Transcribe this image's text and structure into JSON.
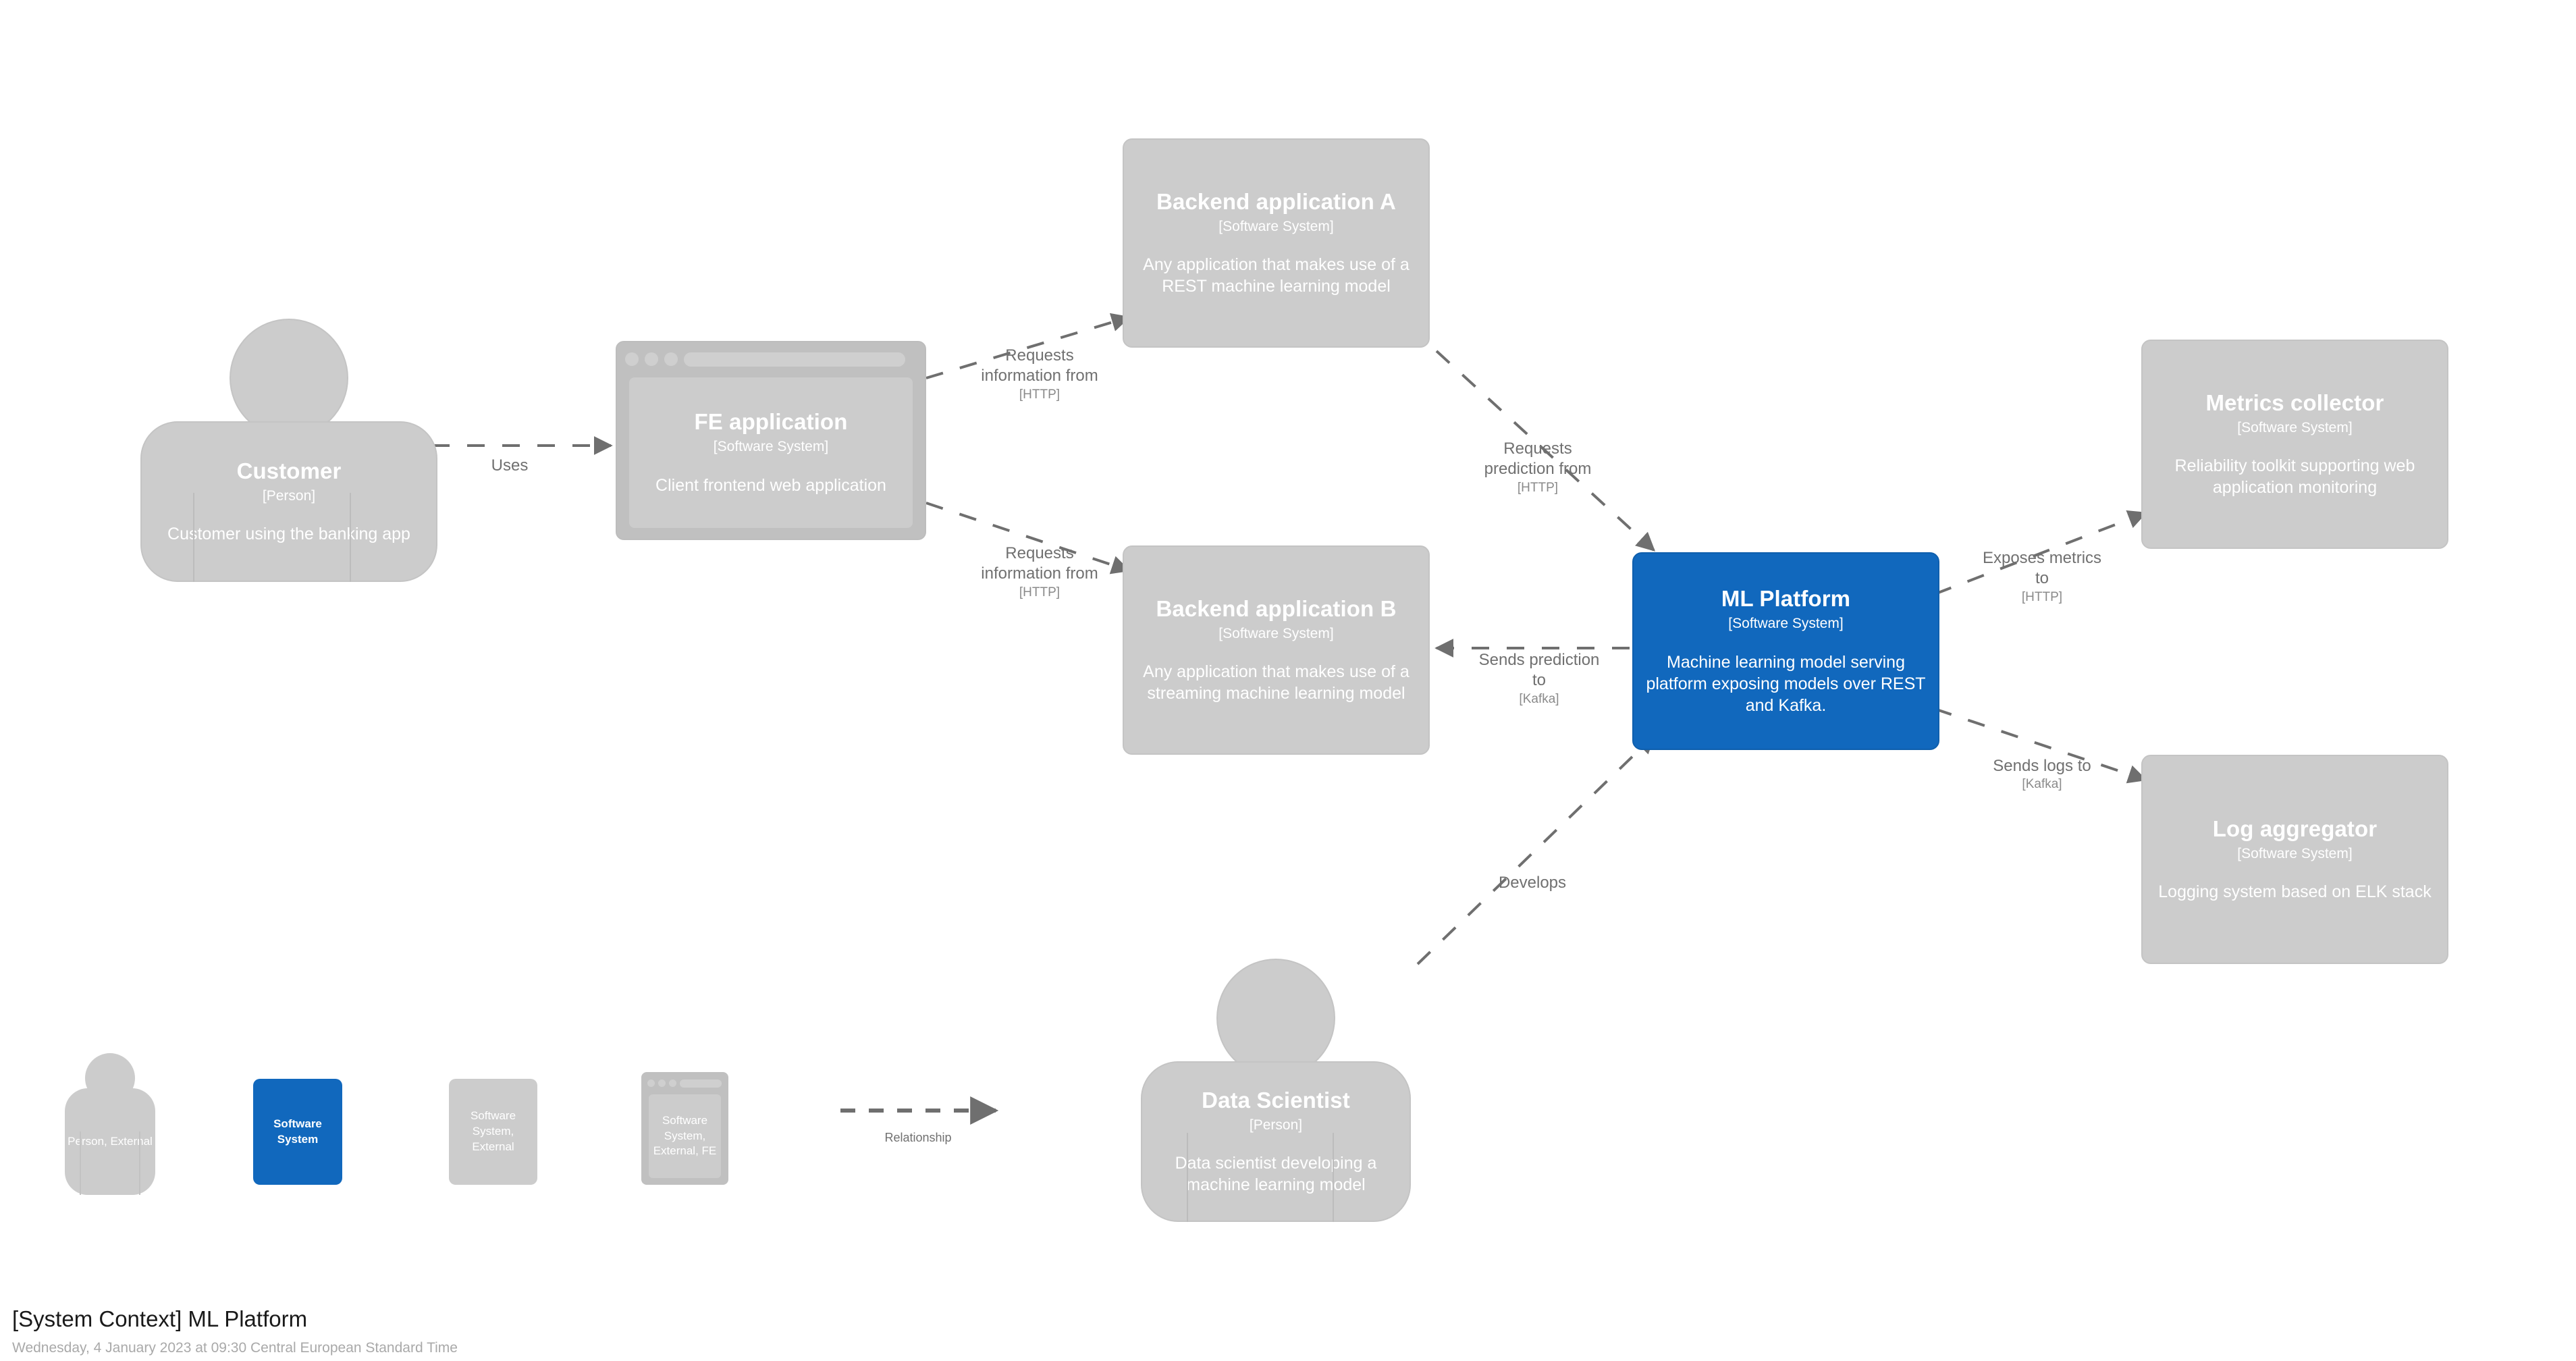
{
  "diagram": {
    "title": "[System Context] ML Platform",
    "timestamp": "Wednesday, 4 January 2023 at 09:30 Central European Standard Time",
    "colors": {
      "accent_blue": "#1168BD",
      "element_gray": "#CCCCCC",
      "relationship_gray": "#707070",
      "background": "#FFFFFF"
    }
  },
  "nodes": {
    "customer": {
      "name": "Customer",
      "stereotype": "[Person]",
      "description": "Customer using the banking app",
      "shape": "person",
      "style": "external"
    },
    "fe_application": {
      "name": "FE application",
      "stereotype": "[Software System]",
      "description": "Client frontend web application",
      "shape": "browser-window",
      "style": "external-fe"
    },
    "backend_a": {
      "name": "Backend application A",
      "stereotype": "[Software System]",
      "description": "Any application that makes use of a REST machine learning model",
      "shape": "box",
      "style": "external"
    },
    "backend_b": {
      "name": "Backend application B",
      "stereotype": "[Software System]",
      "description": "Any application that makes use of a streaming machine learning model",
      "shape": "box",
      "style": "external"
    },
    "ml_platform": {
      "name": "ML Platform",
      "stereotype": "[Software System]",
      "description": "Machine learning model serving platform exposing models over REST and Kafka.",
      "shape": "box",
      "style": "in-scope"
    },
    "metrics_collector": {
      "name": "Metrics collector",
      "stereotype": "[Software System]",
      "description": "Reliability toolkit supporting web application monitoring",
      "shape": "box",
      "style": "external"
    },
    "log_aggregator": {
      "name": "Log aggregator",
      "stereotype": "[Software System]",
      "description": "Logging system based on ELK stack",
      "shape": "box",
      "style": "external"
    },
    "data_scientist": {
      "name": "Data Scientist",
      "stereotype": "[Person]",
      "description": "Data scientist developing a machine learning model",
      "shape": "person",
      "style": "external"
    }
  },
  "relationships": {
    "customer_to_fe": {
      "label": "Uses",
      "technology": ""
    },
    "fe_to_backend_a": {
      "label": "Requests\ninformation from",
      "technology": "[HTTP]"
    },
    "fe_to_backend_b": {
      "label": "Requests\ninformation from",
      "technology": "[HTTP]"
    },
    "backend_a_to_ml": {
      "label": "Requests\nprediction from",
      "technology": "[HTTP]"
    },
    "ml_to_backend_b": {
      "label": "Sends prediction\nto",
      "technology": "[Kafka]"
    },
    "ml_to_metrics": {
      "label": "Exposes metrics\nto",
      "technology": "[HTTP]"
    },
    "ml_to_logs": {
      "label": "Sends logs to",
      "technology": "[Kafka]"
    },
    "data_scientist_to_ml": {
      "label": "Develops",
      "technology": ""
    }
  },
  "legend": {
    "person_external": "Person, External",
    "software_system": "Software System",
    "software_system_external": "Software System,\nExternal",
    "software_system_external_fe": "Software System,\nExternal, FE",
    "relationship": "Relationship"
  }
}
